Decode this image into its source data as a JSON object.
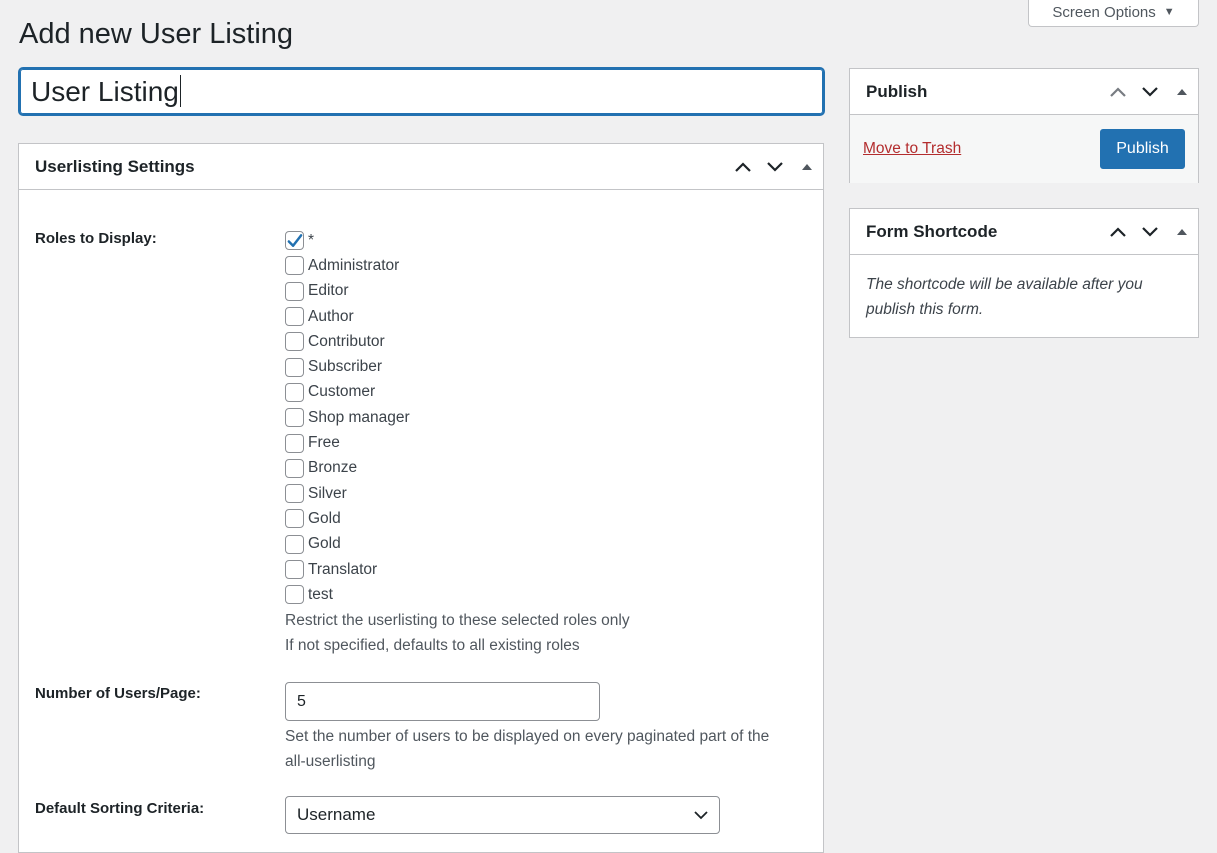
{
  "header": {
    "screen_options_label": "Screen Options",
    "page_title": "Add new User Listing"
  },
  "title_input": {
    "value": "User Listing"
  },
  "settings_box": {
    "title": "Userlisting Settings",
    "roles_label": "Roles to Display:",
    "roles": [
      {
        "label": "*",
        "checked": true
      },
      {
        "label": "Administrator",
        "checked": false
      },
      {
        "label": "Editor",
        "checked": false
      },
      {
        "label": "Author",
        "checked": false
      },
      {
        "label": "Contributor",
        "checked": false
      },
      {
        "label": "Subscriber",
        "checked": false
      },
      {
        "label": "Customer",
        "checked": false
      },
      {
        "label": "Shop manager",
        "checked": false
      },
      {
        "label": "Free",
        "checked": false
      },
      {
        "label": "Bronze",
        "checked": false
      },
      {
        "label": "Silver",
        "checked": false
      },
      {
        "label": "Gold",
        "checked": false
      },
      {
        "label": "Gold",
        "checked": false
      },
      {
        "label": "Translator",
        "checked": false
      },
      {
        "label": "test",
        "checked": false
      }
    ],
    "roles_desc_1": "Restrict the userlisting to these selected roles only",
    "roles_desc_2": "If not specified, defaults to all existing roles",
    "users_per_page_label": "Number of Users/Page:",
    "users_per_page_value": "5",
    "users_per_page_desc_1": "Set the number of users to be displayed on every paginated part of the",
    "users_per_page_desc_2": "all-userlisting",
    "sorting_label": "Default Sorting Criteria:",
    "sorting_value": "Username"
  },
  "publish_box": {
    "title": "Publish",
    "trash_label": "Move to Trash",
    "publish_label": "Publish"
  },
  "shortcode_box": {
    "title": "Form Shortcode",
    "text_1": "The shortcode will be available after you",
    "text_2": "publish this form."
  },
  "colors": {
    "accent": "#2271b1",
    "trash": "#b32d2e",
    "background": "#f0f0f1"
  }
}
